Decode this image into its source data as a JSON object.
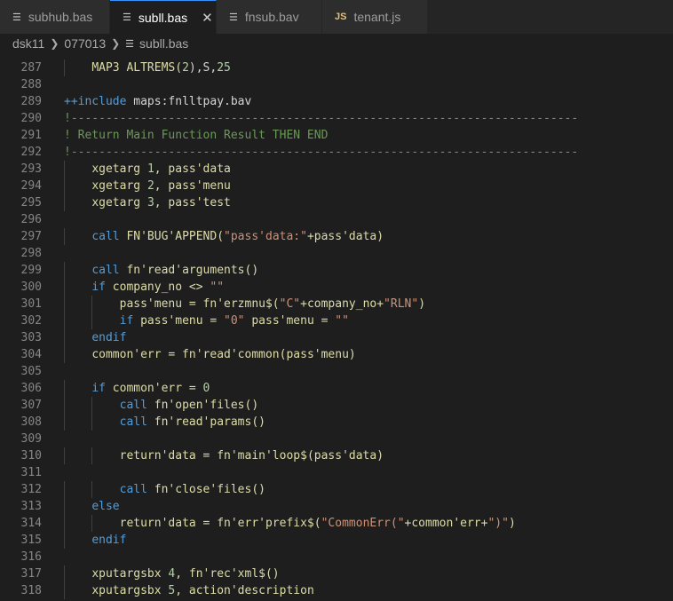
{
  "tabs": [
    {
      "label": "subhub.bas",
      "icon": "lines-icon"
    },
    {
      "label": "subll.bas",
      "icon": "lines-icon",
      "active": true,
      "close": "✕"
    },
    {
      "label": "fnsub.bav",
      "icon": "lines-icon"
    },
    {
      "label": "tenant.js",
      "icon": "js-icon",
      "icon_text": "JS"
    }
  ],
  "breadcrumb": {
    "items": [
      "dsk11",
      "077013",
      "subll.bas"
    ]
  },
  "lines": [
    {
      "n": "287",
      "indent": 1,
      "tokens": [
        [
          "MAP3",
          "fn"
        ],
        [
          " ALTREMS(",
          "fn"
        ],
        [
          "2",
          "num"
        ],
        [
          "),S,",
          "pl"
        ],
        [
          "25",
          "num"
        ]
      ]
    },
    {
      "n": "288",
      "indent": 0,
      "tokens": []
    },
    {
      "n": "289",
      "indent": 0,
      "tokens": [
        [
          "++include",
          "kw"
        ],
        [
          " maps:fnlltpay.bav",
          "pl"
        ]
      ]
    },
    {
      "n": "290",
      "indent": 0,
      "tokens": [
        [
          "!-------------------------------------------------------------------------",
          "cm"
        ]
      ]
    },
    {
      "n": "291",
      "indent": 0,
      "tokens": [
        [
          "! Return Main Function Result THEN END",
          "cm"
        ]
      ]
    },
    {
      "n": "292",
      "indent": 0,
      "tokens": [
        [
          "!-------------------------------------------------------------------------",
          "cm"
        ]
      ]
    },
    {
      "n": "293",
      "indent": 1,
      "tokens": [
        [
          "xgetarg ",
          "fn"
        ],
        [
          "1",
          "num"
        ],
        [
          ", pass'data",
          "fn"
        ]
      ]
    },
    {
      "n": "294",
      "indent": 1,
      "tokens": [
        [
          "xgetarg ",
          "fn"
        ],
        [
          "2",
          "num"
        ],
        [
          ", pass'menu",
          "fn"
        ]
      ]
    },
    {
      "n": "295",
      "indent": 1,
      "tokens": [
        [
          "xgetarg ",
          "fn"
        ],
        [
          "3",
          "num"
        ],
        [
          ", pass'test",
          "fn"
        ]
      ]
    },
    {
      "n": "296",
      "indent": 0,
      "tokens": []
    },
    {
      "n": "297",
      "indent": 1,
      "tokens": [
        [
          "call ",
          "kw"
        ],
        [
          "FN'BUG'APPEND(",
          "fn"
        ],
        [
          "\"pass'data:\"",
          "str"
        ],
        [
          "+pass'data)",
          "fn"
        ]
      ]
    },
    {
      "n": "298",
      "indent": 0,
      "tokens": []
    },
    {
      "n": "299",
      "indent": 1,
      "tokens": [
        [
          "call ",
          "kw"
        ],
        [
          "fn'read'arguments()",
          "fn"
        ]
      ]
    },
    {
      "n": "300",
      "indent": 1,
      "tokens": [
        [
          "if ",
          "kw"
        ],
        [
          "company_no <> ",
          "fn"
        ],
        [
          "\"\"",
          "str"
        ]
      ]
    },
    {
      "n": "301",
      "indent": 2,
      "tokens": [
        [
          "pass'menu = fn'erzmnu$(",
          "fn"
        ],
        [
          "\"C\"",
          "str"
        ],
        [
          "+company_no+",
          "fn"
        ],
        [
          "\"RLN\"",
          "str"
        ],
        [
          ")",
          "fn"
        ]
      ]
    },
    {
      "n": "302",
      "indent": 2,
      "tokens": [
        [
          "if ",
          "kw"
        ],
        [
          "pass'menu = ",
          "fn"
        ],
        [
          "\"0\"",
          "str"
        ],
        [
          " pass'menu = ",
          "fn"
        ],
        [
          "\"\"",
          "str"
        ]
      ]
    },
    {
      "n": "303",
      "indent": 1,
      "tokens": [
        [
          "endif",
          "kw"
        ]
      ]
    },
    {
      "n": "304",
      "indent": 1,
      "tokens": [
        [
          "common'err = fn'read'common(pass'menu)",
          "fn"
        ]
      ]
    },
    {
      "n": "305",
      "indent": 0,
      "tokens": []
    },
    {
      "n": "306",
      "indent": 1,
      "tokens": [
        [
          "if ",
          "kw"
        ],
        [
          "common'err = ",
          "fn"
        ],
        [
          "0",
          "num"
        ]
      ]
    },
    {
      "n": "307",
      "indent": 2,
      "tokens": [
        [
          "call ",
          "kw"
        ],
        [
          "fn'open'files()",
          "fn"
        ]
      ]
    },
    {
      "n": "308",
      "indent": 2,
      "tokens": [
        [
          "call ",
          "kw"
        ],
        [
          "fn'read'params()",
          "fn"
        ]
      ]
    },
    {
      "n": "309",
      "indent": 0,
      "tokens": []
    },
    {
      "n": "310",
      "indent": 2,
      "tokens": [
        [
          "return'data = fn'main'loop$(pass'data)",
          "fn"
        ]
      ]
    },
    {
      "n": "311",
      "indent": 0,
      "tokens": []
    },
    {
      "n": "312",
      "indent": 2,
      "tokens": [
        [
          "call ",
          "kw"
        ],
        [
          "fn'close'files()",
          "fn"
        ]
      ]
    },
    {
      "n": "313",
      "indent": 1,
      "tokens": [
        [
          "else",
          "kw"
        ]
      ]
    },
    {
      "n": "314",
      "indent": 2,
      "tokens": [
        [
          "return'data = fn'err'prefix$(",
          "fn"
        ],
        [
          "\"CommonErr(\"",
          "str"
        ],
        [
          "+common'err+",
          "fn"
        ],
        [
          "\")\"",
          "str"
        ],
        [
          ")",
          "fn"
        ]
      ]
    },
    {
      "n": "315",
      "indent": 1,
      "tokens": [
        [
          "endif",
          "kw"
        ]
      ]
    },
    {
      "n": "316",
      "indent": 0,
      "tokens": []
    },
    {
      "n": "317",
      "indent": 1,
      "tokens": [
        [
          "xputargsbx ",
          "fn"
        ],
        [
          "4",
          "num"
        ],
        [
          ", fn'rec'xml$()",
          "fn"
        ]
      ]
    },
    {
      "n": "318",
      "indent": 1,
      "tokens": [
        [
          "xputargsbx ",
          "fn"
        ],
        [
          "5",
          "num"
        ],
        [
          ", action'description",
          "fn"
        ]
      ]
    }
  ],
  "colors": {
    "keyword": "#569cd6",
    "function": "#dcdcaa",
    "string": "#ce9178",
    "number": "#b5cea8",
    "comment": "#6a9955",
    "accent": "#3794ff"
  }
}
